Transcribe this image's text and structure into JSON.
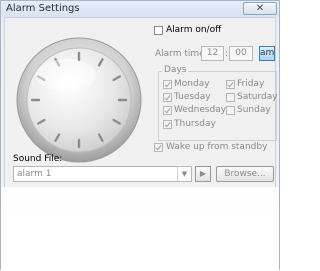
{
  "window": {
    "title": "Alarm Settings",
    "close_glyph": "✕"
  },
  "alarm_toggle": {
    "label": "Alarm on/off",
    "checked": false
  },
  "alarm_time": {
    "label": "Alarm time:",
    "hour": "12",
    "minute": "00",
    "ampm": "am",
    "separator": ":"
  },
  "days": {
    "title": "Days",
    "items": [
      {
        "label": "Monday",
        "checked": true
      },
      {
        "label": "Tuesday",
        "checked": true
      },
      {
        "label": "Wednesday",
        "checked": true
      },
      {
        "label": "Thursday",
        "checked": true
      },
      {
        "label": "Friday",
        "checked": true
      },
      {
        "label": "Saturday",
        "checked": false
      },
      {
        "label": "Sunday",
        "checked": false
      }
    ]
  },
  "wake": {
    "label": "Wake up from standby",
    "checked": true
  },
  "sound": {
    "label": "Sound File:",
    "value": "alarm 1",
    "play_glyph": "▶",
    "browse_label": "Browse..."
  },
  "icons": {
    "clock": "clock-face-icon",
    "play": "play-icon",
    "dropdown": "chevron-down-icon",
    "close": "close-icon"
  }
}
